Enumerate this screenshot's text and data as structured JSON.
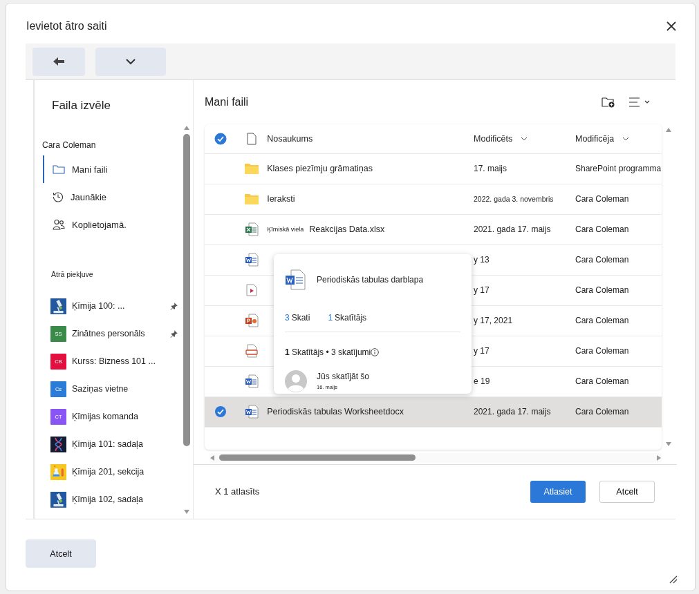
{
  "dialog": {
    "title": "Ievietot ātro saiti"
  },
  "sidebar": {
    "title": "Faila izvēle",
    "account": "Cara Coleman",
    "nav": [
      {
        "kind": "folder",
        "label": "Mani faili",
        "selected": true
      },
      {
        "kind": "recent",
        "label": "Jaunākie",
        "selected": false
      },
      {
        "kind": "shared",
        "label": "Koplietojamā.",
        "selected": false
      }
    ],
    "quick_access_title": "Ātrā piekļuve",
    "quick_access": [
      {
        "kind": "microscope",
        "label": "Ķīmija 100: ...",
        "pinned": true
      },
      {
        "kind": "initials",
        "initials": "SS",
        "color": "#3a8a4a",
        "label": "Zinātnes personāls",
        "pinned": true
      },
      {
        "kind": "initials",
        "initials": "CB",
        "color": "#e3103f",
        "label": "Kurss: Bizness 101 ...",
        "pinned": false
      },
      {
        "kind": "initials",
        "initials": "Cs",
        "color": "#2b7bd8",
        "label": "Saziņas vietne",
        "pinned": false
      },
      {
        "kind": "initials",
        "initials": "CT",
        "color": "#8a55f5",
        "label": "Ķīmijas komanda",
        "pinned": false
      },
      {
        "kind": "dna",
        "label": "Ķīmija 101: sadaļa",
        "pinned": false
      },
      {
        "kind": "flask",
        "label": "Ķīmija 201, sekcija",
        "pinned": false
      },
      {
        "kind": "microscope",
        "label": "Ķīmija 102, sadaļa",
        "pinned": false
      }
    ]
  },
  "main": {
    "title": "Mani faili",
    "table": {
      "all_checked": true,
      "columns": [
        "Nosaukums",
        "Modificēts",
        "Modificēja"
      ],
      "rows": [
        {
          "kind": "folder",
          "name": "Klases piezīmju grāmatiņas",
          "modified": "17. maijs",
          "modified_by": "SharePoint programma",
          "selected": false
        },
        {
          "kind": "folder",
          "name": "Ieraksti",
          "modified": "2022. gada 3. novembris",
          "modified_by": "Cara Coleman",
          "selected": false
        },
        {
          "kind": "excel",
          "name_prefix": "Ķīmiskā viela",
          "name": "Reakcijas Data.xlsx",
          "modified": "2021. gada 17. maijs",
          "modified_by": "Cara Coleman",
          "selected": false
        },
        {
          "kind": "word",
          "modified": "y 13",
          "modified_by": "Cara Coleman",
          "selected": false
        },
        {
          "kind": "video",
          "modified": "y 17",
          "modified_by": "Cara Coleman",
          "selected": false
        },
        {
          "kind": "powerpoint",
          "modified": "y 17, 2021",
          "modified_by": "Cara Coleman",
          "selected": false
        },
        {
          "kind": "recording",
          "modified": "y 17",
          "modified_by": "Cara Coleman",
          "selected": false
        },
        {
          "kind": "word",
          "modified": "e 19",
          "modified_by": "Cara Coleman",
          "selected": false
        },
        {
          "kind": "word",
          "name": "Periodiskās tabulas Worksheetdocx",
          "modified": "2021. gada 17. maijs",
          "modified_by": "Cara Coleman",
          "selected": true
        }
      ]
    },
    "popup": {
      "title": "Periodiskās tabulas darblapa",
      "stats": [
        {
          "value": "3",
          "label": "Skati"
        },
        {
          "value": "1",
          "label": "Skatītājs"
        }
      ],
      "summary": "**1** Skatītājs • 3 skatījumi",
      "viewer": {
        "text": "Jūs skatījāt šo",
        "date": "16. maijs"
      }
    },
    "selection": "X 1 atlasīts",
    "primary_button": "Atlasiet",
    "cancel_button": "Atcelt"
  },
  "footer_button": "Atcelt"
}
